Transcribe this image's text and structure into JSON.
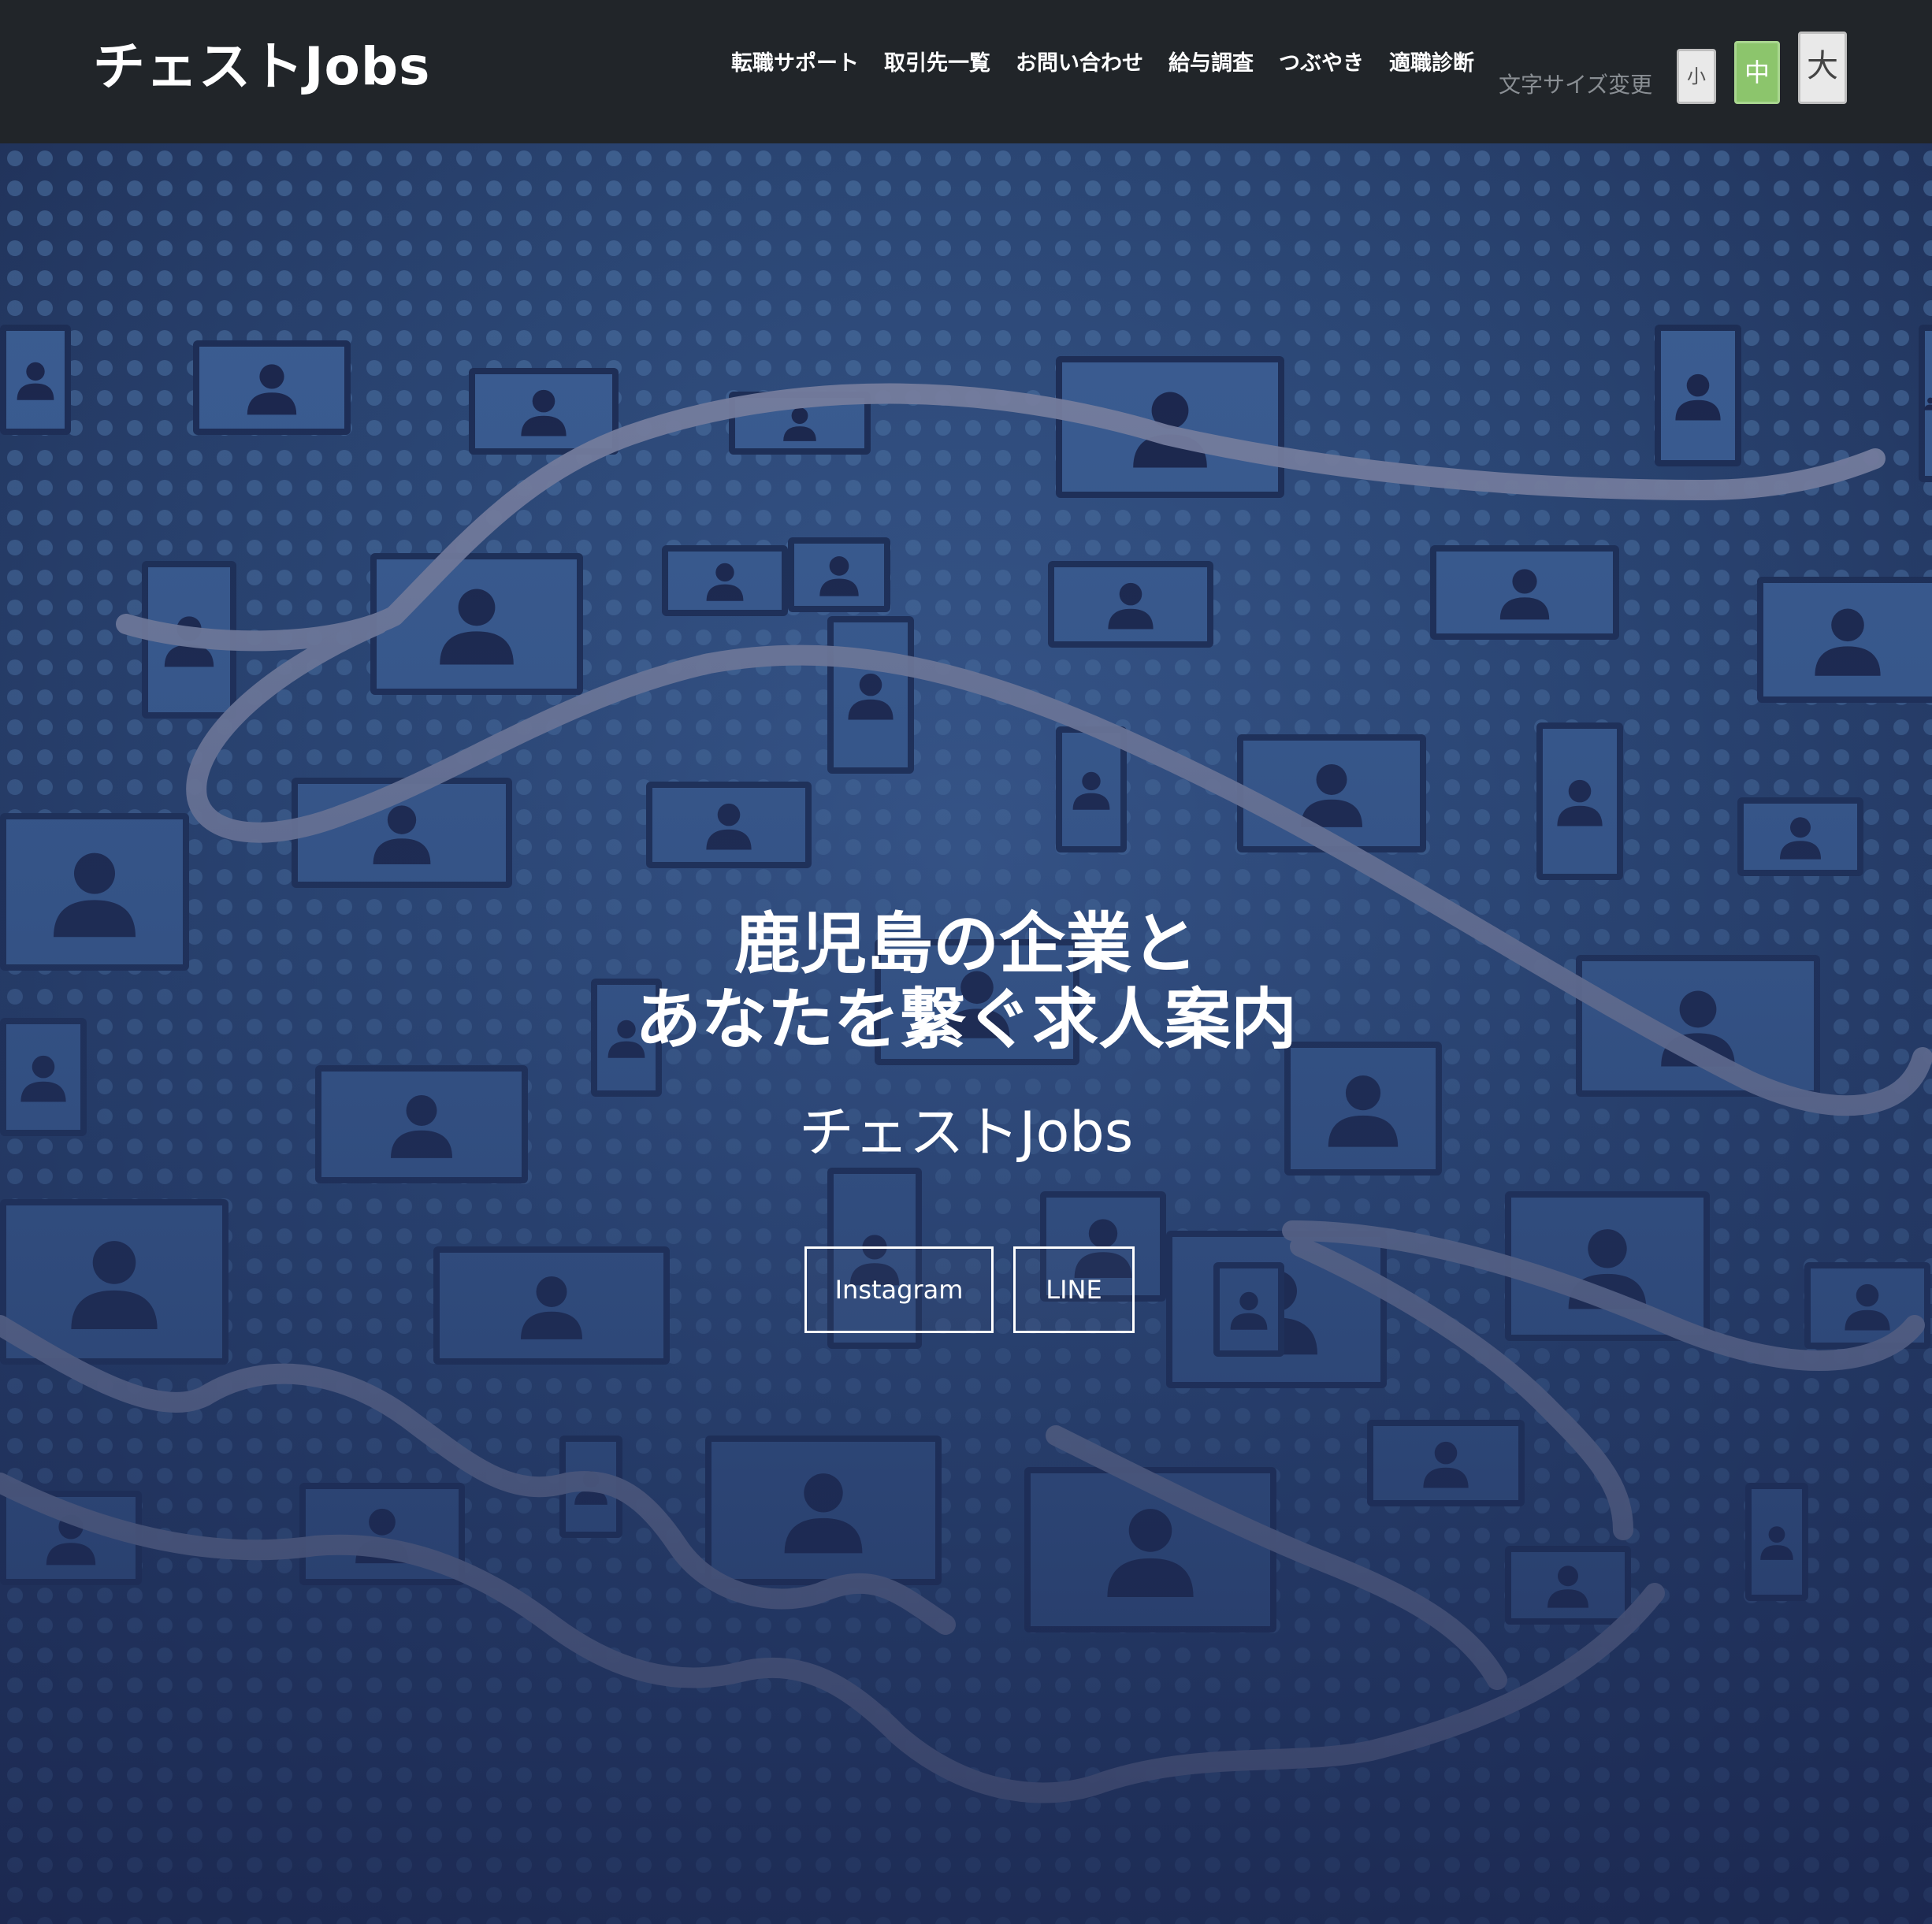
{
  "header": {
    "brand": "チェストJobs",
    "nav": [
      "転職サポート",
      "取引先一覧",
      "お問い合わせ",
      "給与調査",
      "つぶやき",
      "適職診断"
    ],
    "font_size_label": "文字サイズ変更",
    "font_size_buttons": {
      "small": "小",
      "medium": "中",
      "large": "大"
    },
    "active_font_size": "medium"
  },
  "hero": {
    "title_line1": "鹿児島の企業と",
    "title_line2": "あなたを繋ぐ求人案内",
    "subtitle": "チェストJobs",
    "buttons": {
      "instagram": "Instagram",
      "line": "LINE"
    }
  },
  "colors": {
    "navbar_bg": "#212529",
    "active_size_button": "#8cc56c",
    "hero_bg": "#2b4674"
  }
}
